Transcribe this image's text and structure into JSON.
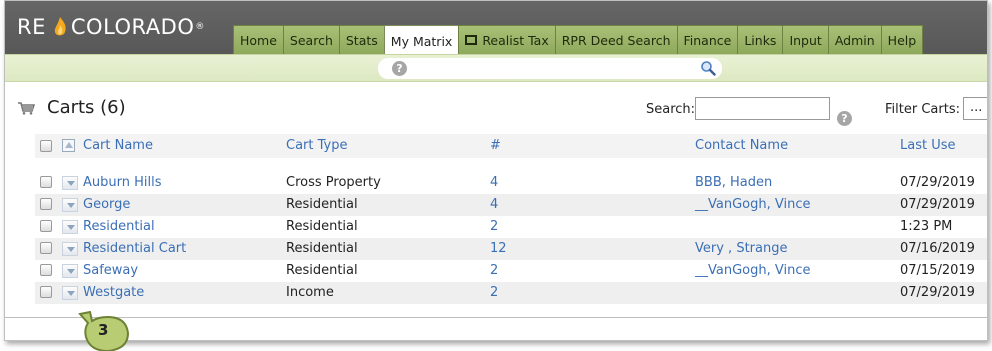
{
  "header": {
    "logo_left": "RE",
    "logo_right": "COLORADO",
    "logo_mark": "®"
  },
  "nav": {
    "tabs": [
      {
        "label": "Home"
      },
      {
        "label": "Search"
      },
      {
        "label": "Stats"
      },
      {
        "label": "My Matrix",
        "active": true
      },
      {
        "label": "Realist Tax",
        "icon": "window-icon"
      },
      {
        "label": "RPR Deed Search"
      },
      {
        "label": "Finance"
      },
      {
        "label": "Links"
      },
      {
        "label": "Input"
      },
      {
        "label": "Admin"
      },
      {
        "label": "Help"
      }
    ]
  },
  "toolbar": {
    "help_icon": "help-icon",
    "search_icon": "magnifier-icon"
  },
  "page": {
    "title": "Carts (6)",
    "title_icon": "cart-icon"
  },
  "search": {
    "label": "Search:",
    "value": "",
    "help_icon": "help-icon"
  },
  "filter": {
    "label": "Filter Carts:",
    "value": "..."
  },
  "table": {
    "headers": {
      "name": "Cart Name",
      "type": "Cart Type",
      "count": "#",
      "contact": "Contact Name",
      "last_use": "Last Use"
    },
    "rows": [
      {
        "name": "Auburn Hills",
        "type": "Cross Property",
        "count": "4",
        "contact": "BBB, Haden",
        "last_use": "07/29/2019"
      },
      {
        "name": "George",
        "type": "Residential",
        "count": "4",
        "contact": "__VanGogh, Vince",
        "last_use": "07/29/2019"
      },
      {
        "name": "Residential",
        "type": "Residential",
        "count": "2",
        "contact": "",
        "last_use": "1:23 PM"
      },
      {
        "name": "Residential Cart",
        "type": "Residential",
        "count": "12",
        "contact": "Very , Strange",
        "last_use": "07/16/2019"
      },
      {
        "name": "Safeway",
        "type": "Residential",
        "count": "2",
        "contact": "__VanGogh, Vince",
        "last_use": "07/15/2019"
      },
      {
        "name": "Westgate",
        "type": "Income",
        "count": "2",
        "contact": "",
        "last_use": "07/29/2019"
      }
    ]
  },
  "callout": {
    "label": "3"
  },
  "colors": {
    "header_bg": "#5f5f5f",
    "tab_green": "#9db46a",
    "toolbar_green": "#e3edcb",
    "link_blue": "#3b6fb5",
    "callout_green": "#b3c96e"
  }
}
